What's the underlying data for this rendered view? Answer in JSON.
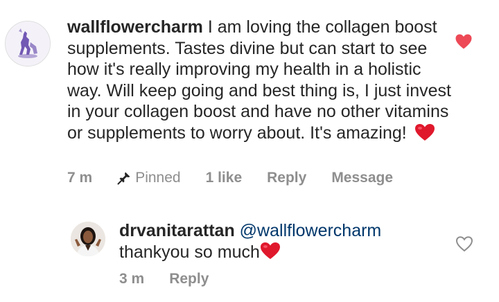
{
  "comment": {
    "username": "wallflowercharm",
    "text": "I am loving the collagen boost supplements. Tastes divine but can start to see how it's really improving my health in a holistic way. Will keep going and best thing is, I just invest in your collagen boost and have no other vitamins or supplements to worry about. It's amazing!",
    "time": "7 m",
    "pinned_label": "Pinned",
    "likes": "1 like",
    "reply_label": "Reply",
    "message_label": "Message",
    "liked": true,
    "like_color": "#ed4956"
  },
  "reply": {
    "username": "drvanitarattan",
    "mention": "@wallflowercharm",
    "text": "thankyou so much",
    "time": "3 m",
    "reply_label": "Reply",
    "liked": false
  },
  "colors": {
    "text": "#262626",
    "meta": "#8e8e8e",
    "mention": "#00376b",
    "heart": "#ed4956"
  },
  "icons": {
    "pin": "pin-icon",
    "heart_filled": "heart-filled-icon",
    "heart_outline": "heart-outline-icon",
    "heart_emoji": "red-heart-emoji"
  }
}
